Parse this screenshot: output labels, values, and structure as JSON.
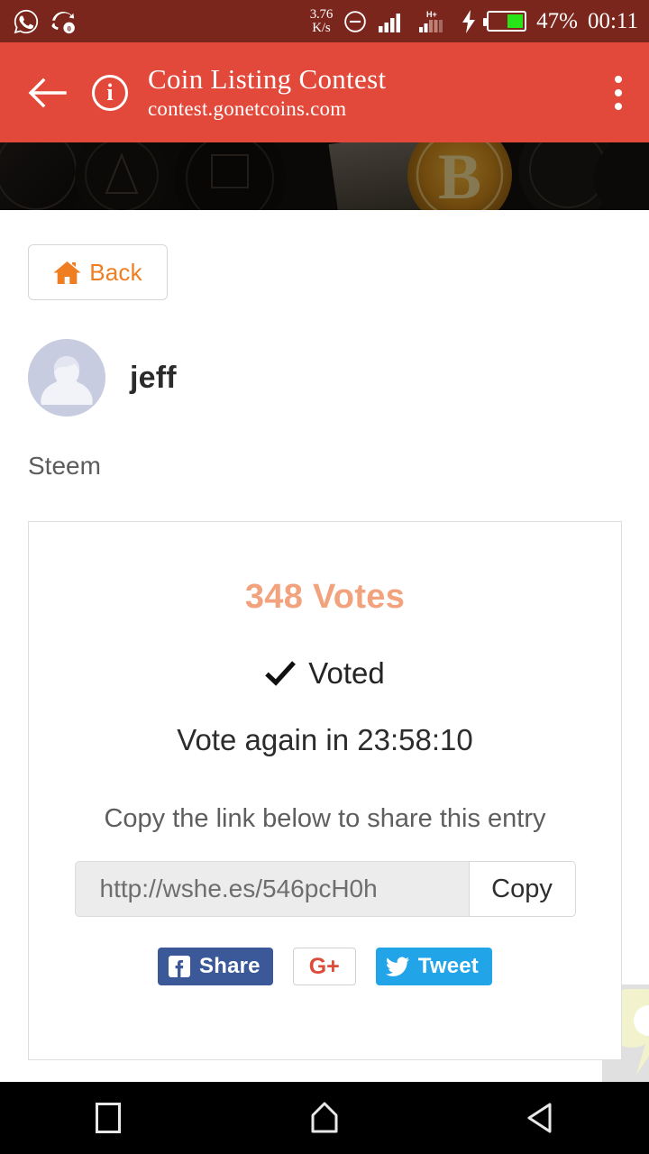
{
  "status_bar": {
    "background": "#7a261d",
    "icons_left": [
      "whatsapp-icon",
      "missed-call-icon"
    ],
    "missed_call_badge": "0",
    "data_speed_value": "3.76",
    "data_speed_unit": "K/s",
    "dnd_icon": "do-not-disturb-icon",
    "network_type": "H+",
    "charging": true,
    "battery_percent": "47%",
    "battery_level": 47,
    "clock": "00:11"
  },
  "app_bar": {
    "background": "#e2493a",
    "back_icon": "arrow-left-icon",
    "info_icon_letter": "i",
    "title": "Coin Listing Contest",
    "subtitle": "contest.gonetcoins.com",
    "overflow_icon": "more-vertical-icon"
  },
  "banner": {
    "alt": "cryptocurrency coins banner"
  },
  "page": {
    "back_button": {
      "label": "Back",
      "icon": "home-icon",
      "color": "#ef7e23"
    },
    "profile": {
      "avatar": "default-user-avatar",
      "username": "jeff"
    },
    "coin_name": "Steem",
    "card": {
      "votes_text": "348 Votes",
      "votes_count": 348,
      "votes_color": "#f2a27c",
      "voted_label": "Voted",
      "voted_icon": "check-icon",
      "vote_again_text": "Vote again in 23:58:10",
      "countdown": "23:58:10",
      "copy_hint": "Copy the link below to share this entry",
      "share_link": "http://wshe.es/546pcH0h",
      "copy_button_label": "Copy",
      "social": {
        "facebook_label": "Share",
        "facebook_icon": "facebook-icon",
        "facebook_color": "#3b5998",
        "google_label": "G+",
        "google_icon": "google-plus-icon",
        "google_color": "#dd4b39",
        "twitter_label": "Tweet",
        "twitter_icon": "twitter-icon",
        "twitter_color": "#21a4e8"
      }
    }
  },
  "nav_bar": {
    "recents_icon": "square-icon",
    "home_icon": "home-pentagon-icon",
    "back_icon": "triangle-left-icon"
  }
}
